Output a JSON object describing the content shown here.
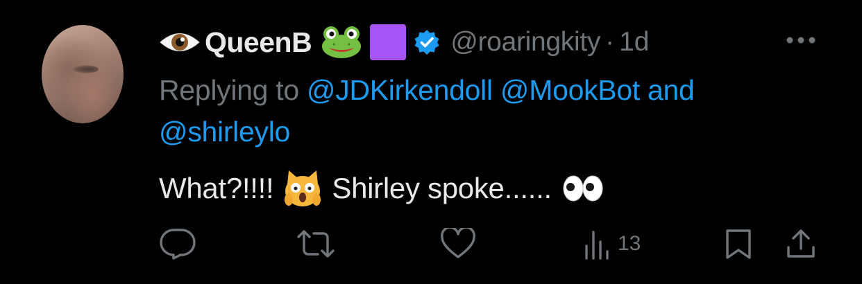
{
  "tweet": {
    "display_name": "QueenB",
    "name_emojis": [
      "eye-emoji",
      "frog-emoji",
      "purple-square-emoji"
    ],
    "verified": true,
    "handle": "@roaringkity",
    "separator": "·",
    "time": "1d",
    "reply": {
      "prefix": "Replying to",
      "mentions": [
        "@JDKirkendoll",
        "@MookBot",
        "@shirleylo"
      ],
      "conjunction": "and"
    },
    "text_before_emoji": "What?!!!!",
    "text_emoji": "weary-cat-emoji",
    "text_after_emoji": "Shirley spoke......",
    "text_trailing_emoji": "eyes-emoji",
    "views_count": "13"
  },
  "actions": [
    "reply-icon",
    "retweet-icon",
    "like-icon",
    "views-icon",
    "bookmark-icon",
    "share-icon"
  ],
  "colors": {
    "background": "#000000",
    "primary_text": "#e7e9ea",
    "secondary_text": "#71767b",
    "link": "#1d9bf0",
    "verified": "#1d9bf0"
  }
}
